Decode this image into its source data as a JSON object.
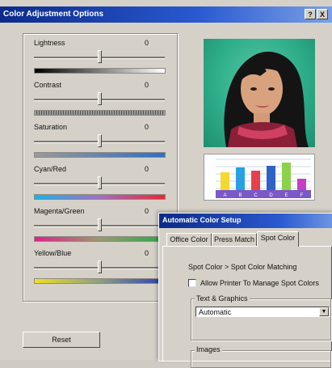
{
  "dialog": {
    "title": "Color Adjustment Options",
    "help_label": "?",
    "close_label": "X",
    "reset_label": "Reset"
  },
  "sliders": [
    {
      "label": "Lightness",
      "value": "0",
      "position": 0.5,
      "ramp": "lightness"
    },
    {
      "label": "Contrast",
      "value": "0",
      "position": 0.5,
      "ramp": "contrast"
    },
    {
      "label": "Saturation",
      "value": "0",
      "position": 0.5,
      "ramp": "saturation"
    },
    {
      "label": "Cyan/Red",
      "value": "0",
      "position": 0.5,
      "ramp": "cyan-red"
    },
    {
      "label": "Magenta/Green",
      "value": "0",
      "position": 0.5,
      "ramp": "magenta-green"
    },
    {
      "label": "Yellow/Blue",
      "value": "0",
      "position": 0.5,
      "ramp": "yellow-blue"
    }
  ],
  "preview": {
    "chart_letters": [
      "A",
      "B",
      "C",
      "D",
      "E",
      "F"
    ],
    "chart_bar_colors": [
      "#f5d830",
      "#27a0e6",
      "#e8404a",
      "#2f62c8",
      "#8cd14a",
      "#c43ec6"
    ]
  },
  "overlay": {
    "title": "Automatic Color Setup",
    "tabs": [
      "Office Color",
      "Press Match",
      "Spot Color"
    ],
    "active_tab": "Spot Color",
    "heading": "Spot Color > Spot Color Matching",
    "checkbox_label": "Allow Printer To Manage Spot Colors",
    "checkbox_checked": false,
    "group1_label": "Text & Graphics",
    "group1_value": "Automatic",
    "group2_label": "Images"
  },
  "colors": {
    "title_start": "#0b2a8a",
    "title_end": "#7aa0e8",
    "dialog_bg": "#d6d1c8"
  }
}
